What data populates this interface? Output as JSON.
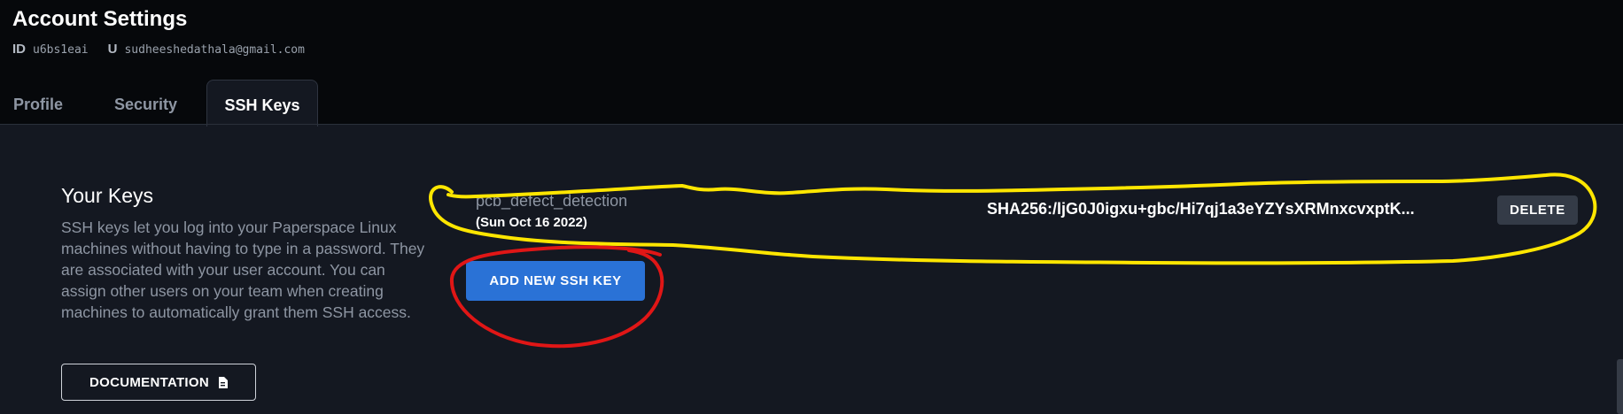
{
  "header": {
    "title": "Account Settings",
    "id_label": "ID",
    "id_value": "u6bs1eai",
    "user_label": "U",
    "user_value": "sudheeshedathala@gmail.com"
  },
  "tabs": [
    {
      "label": "Profile",
      "active": false
    },
    {
      "label": "Security",
      "active": false
    },
    {
      "label": "SSH Keys",
      "active": true
    }
  ],
  "keys_section": {
    "title": "Your Keys",
    "description": "SSH keys let you log into your Paperspace Linux machines without having to type in a password. They are associated with your user account. You can assign other users on your team when creating machines to automatically grant them SSH access.",
    "documentation_label": "DOCUMENTATION",
    "documentation_icon": "document-icon",
    "add_button_label": "ADD NEW SSH KEY",
    "keys": [
      {
        "name": "pcb_defect_detection",
        "date": "(Sun Oct 16 2022)",
        "fingerprint": "SHA256:/ljG0J0igxu+gbc/Hi7qj1a3eYZYsXRMnxcvxptK...",
        "delete_label": "DELETE"
      }
    ]
  },
  "colors": {
    "background": "#141821",
    "header_background": "#06080b",
    "primary_button": "#2a72d6",
    "secondary_button": "#343b47",
    "annotation_yellow": "#ffe600",
    "annotation_red": "#e01616"
  }
}
